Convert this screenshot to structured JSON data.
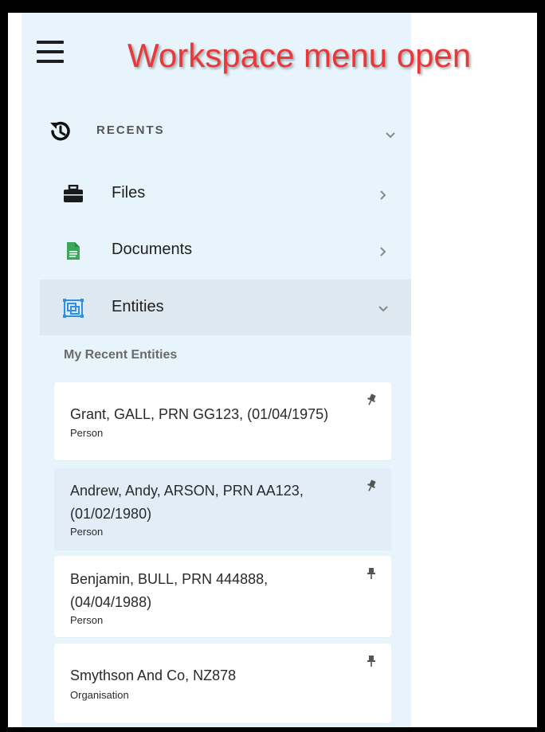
{
  "annotation": "Workspace menu open",
  "recents": {
    "label": "RECENTS"
  },
  "nav": {
    "files": "Files",
    "documents": "Documents",
    "entities": "Entities"
  },
  "entities_section": {
    "title": "My Recent Entities",
    "items": [
      {
        "line1": "Grant, GALL, PRN GG123, (01/04/1975)",
        "line2": "",
        "type": "Person",
        "pin_style": "tilted"
      },
      {
        "line1": "Andrew, Andy, ARSON, PRN AA123,",
        "line2": "(01/02/1980)",
        "type": "Person",
        "pin_style": "tilted"
      },
      {
        "line1": "Benjamin, BULL, PRN 444888,",
        "line2": "(04/04/1988)",
        "type": "Person",
        "pin_style": "upright"
      },
      {
        "line1": "Smythson And Co, NZ878",
        "line2": "",
        "type": "Organisation",
        "pin_style": "upright"
      }
    ]
  },
  "colors": {
    "sidebar_bg": "#e8f4fb",
    "annotation": "#e8393a",
    "documents_icon": "#3aa858",
    "entities_icon": "#2f8fe3"
  },
  "icons": {
    "menu": "hamburger-icon",
    "recents": "history-icon",
    "files": "briefcase-icon",
    "documents": "document-icon",
    "entities": "entities-icon",
    "pin": "pin-icon"
  }
}
